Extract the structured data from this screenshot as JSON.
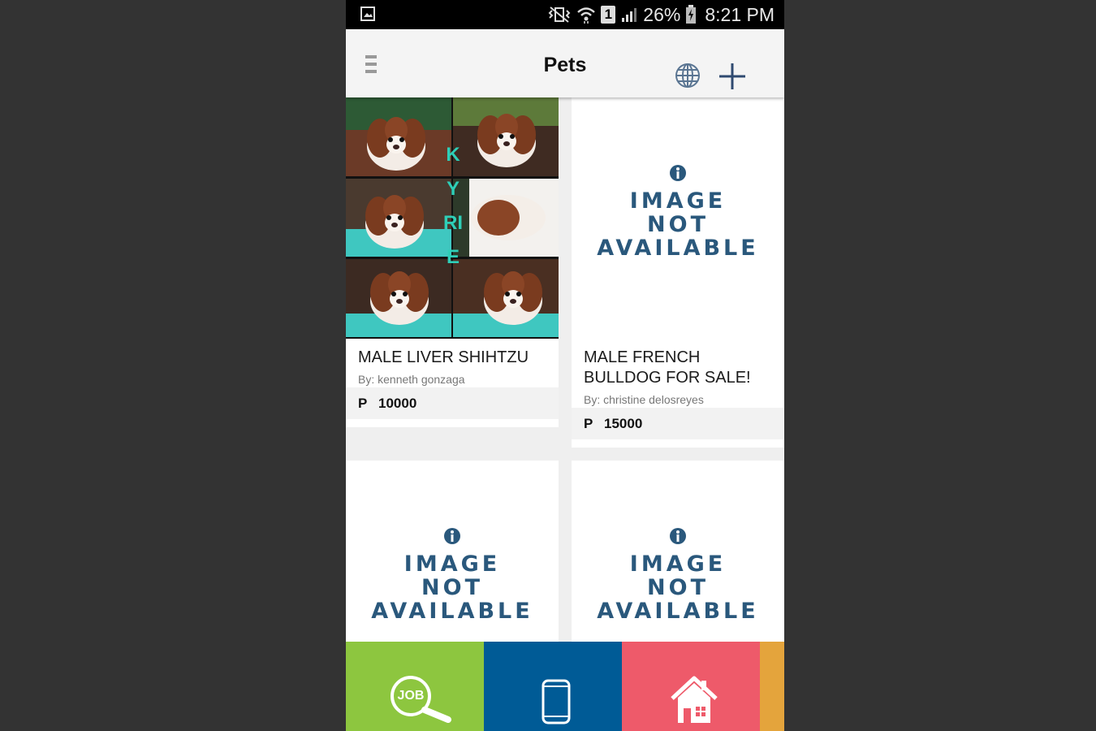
{
  "status_bar": {
    "battery_percent": "26%",
    "time": "8:21 PM",
    "sim_slot": "1"
  },
  "header": {
    "title": "Pets",
    "menu_icon": "hamburger-menu-icon",
    "globe_icon": "globe-icon",
    "add_icon": "plus-icon"
  },
  "listings": [
    {
      "title": "MALE LIVER SHIHTZU",
      "author": "By: kenneth gonzaga",
      "currency": "P",
      "price": "10000",
      "watermark": "KYRIE"
    },
    {
      "title": "MALE FRENCH BULLDOG FOR SALE!",
      "author": "By: christine delosreyes",
      "currency": "P",
      "price": "15000",
      "placeholder": [
        "IMAGE",
        "NOT",
        "AVAILABLE"
      ]
    },
    {
      "placeholder": [
        "IMAGE",
        "NOT",
        "AVAILABLE"
      ]
    },
    {
      "placeholder": [
        "IMAGE",
        "NOT",
        "AVAILABLE"
      ]
    }
  ],
  "bottom_nav": [
    {
      "label": "JOB",
      "icon": "job-search-icon",
      "color": "#8dc63f"
    },
    {
      "icon": "mobile-phone-icon",
      "color": "#005b96"
    },
    {
      "icon": "house-icon",
      "color": "#ee5a6a"
    },
    {
      "icon": "more-category-tab",
      "color": "#e4a43c"
    }
  ]
}
